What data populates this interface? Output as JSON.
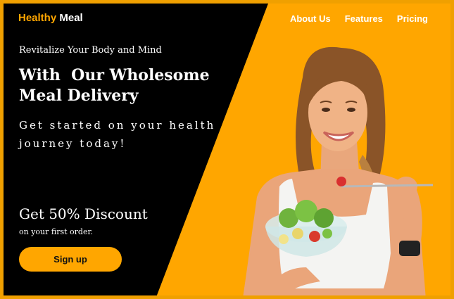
{
  "brand": {
    "part1": "Healthy",
    "part2": "Meal"
  },
  "nav": {
    "items": [
      "About Us",
      "Features",
      "Pricing"
    ]
  },
  "hero": {
    "tagline": "Revitalize Your Body and Mind",
    "headline_line1": "With  Our Wholesome",
    "headline_line2": "Meal Delivery",
    "subhead": "Get started on your health journey today!",
    "discount": "Get 50% Discount",
    "discount_sub": "on your first order.",
    "cta_label": "Sign up"
  },
  "colors": {
    "accent": "#ffa600",
    "panel": "#000000",
    "text": "#ffffff"
  },
  "photo": {
    "subject": "woman-eating-salad"
  }
}
